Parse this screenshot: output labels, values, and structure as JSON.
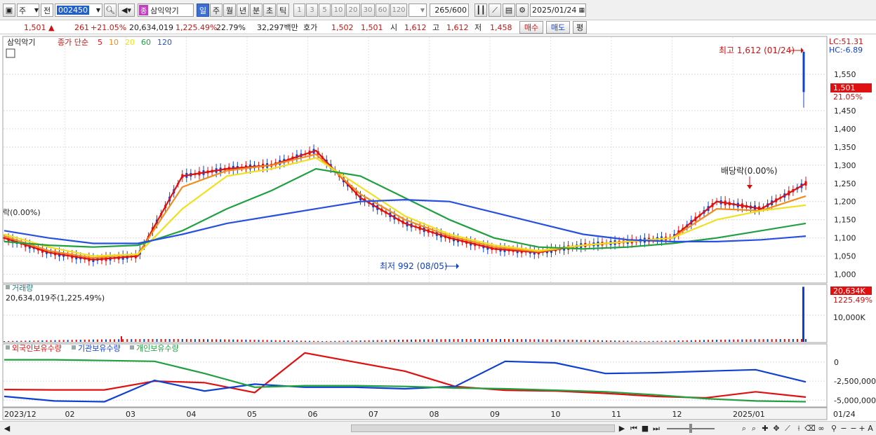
{
  "toolbar": {
    "market": "주",
    "prev": "전",
    "code": "002450",
    "name": "삼익악기",
    "badge": "종",
    "periods": [
      "일",
      "주",
      "월",
      "년",
      "분",
      "초",
      "틱"
    ],
    "active_period": "일",
    "minute_steps": [
      "1",
      "3",
      "5",
      "10",
      "20",
      "30",
      "60",
      "120"
    ],
    "count": "265",
    "total": "/600",
    "date": "2025/01/24"
  },
  "quote": {
    "price": "1,501",
    "change": "261",
    "change_pct": "+21.05%",
    "volume": "20,634,019",
    "volume_pct": "1,225.49%",
    "turnover": "22.79%",
    "amount": "32,297백만",
    "bid_label": "호가",
    "ask": "1,502",
    "bid": "1,501",
    "open_label": "시",
    "open": "1,612",
    "high_label": "고",
    "high": "1,612",
    "low_label": "저",
    "low": "1,458",
    "buy_button": "매수",
    "sell_button": "매도",
    "eval_button": "평"
  },
  "price_panel": {
    "title": "삼익악기",
    "legend_type": "종가 단순",
    "ma_periods": [
      "5",
      "10",
      "20",
      "60",
      "120"
    ],
    "ma_colors": [
      "#e01010",
      "#f08c20",
      "#f0e020",
      "#20a040",
      "#2850e0"
    ],
    "lc_label": "LC:51.31",
    "hc_label": "HC:-6.89",
    "last_price_tag": "1,501",
    "last_pct_tag": "21.05%",
    "high_note": "최고 1,612 (01/24)",
    "low_note": "최저 992 (08/05)",
    "div_note": "배당락(0.00%)",
    "div_note_left": "락(0.00%)"
  },
  "volume_panel": {
    "title": "거래량",
    "value": "20,634,019주(1,225.49%)",
    "tag": "20,634K",
    "tag_pct": "1225.49%",
    "tick": "10,000K"
  },
  "holdings_panel": {
    "legend": [
      {
        "name": "외국인보유수량",
        "color": "#e01010"
      },
      {
        "name": "기관보유수량",
        "color": "#1040d0"
      },
      {
        "name": "개인보유수량",
        "color": "#20a040"
      }
    ],
    "ticks": [
      "0",
      "-2,500,000",
      "-5,000,000"
    ]
  },
  "x_axis": {
    "labels": [
      "2023/12",
      "02",
      "03",
      "04",
      "05",
      "06",
      "07",
      "08",
      "09",
      "10",
      "11",
      "12",
      "2025/01",
      "01/24"
    ]
  },
  "chart_data": [
    {
      "type": "line",
      "title": "삼익악기",
      "xlabel": "",
      "ylabel": "",
      "categories": [
        "2023/12",
        "02",
        "03",
        "04",
        "05",
        "06",
        "07",
        "08",
        "09",
        "10",
        "11",
        "12",
        "2025/01",
        "01/24"
      ],
      "ylim": [
        980,
        1650
      ],
      "y_ticks": [
        1000,
        1050,
        1100,
        1150,
        1200,
        1250,
        1300,
        1350,
        1400,
        1450,
        1550
      ],
      "series": [
        {
          "name": "5",
          "values": [
            1100,
            1060,
            1040,
            1050,
            1270,
            1290,
            1300,
            1340,
            1210,
            1140,
            1100,
            1070,
            1060,
            1080,
            1090,
            1100,
            1200,
            1180,
            1250
          ]
        },
        {
          "name": "10",
          "values": [
            1105,
            1065,
            1045,
            1055,
            1240,
            1285,
            1300,
            1330,
            1220,
            1150,
            1105,
            1075,
            1062,
            1080,
            1090,
            1100,
            1180,
            1175,
            1215
          ]
        },
        {
          "name": "20",
          "values": [
            1110,
            1075,
            1050,
            1055,
            1180,
            1270,
            1290,
            1320,
            1240,
            1160,
            1110,
            1080,
            1065,
            1080,
            1090,
            1100,
            1150,
            1175,
            1190
          ]
        },
        {
          "name": "60",
          "values": [
            1090,
            1080,
            1075,
            1080,
            1120,
            1180,
            1230,
            1290,
            1270,
            1210,
            1150,
            1100,
            1075,
            1070,
            1075,
            1085,
            1100,
            1120,
            1140
          ]
        },
        {
          "name": "120",
          "values": [
            1120,
            1100,
            1085,
            1085,
            1110,
            1140,
            1160,
            1180,
            1200,
            1205,
            1200,
            1170,
            1140,
            1110,
            1095,
            1090,
            1090,
            1095,
            1105
          ]
        }
      ],
      "annotations": [
        {
          "text": "최고 1,612 (01/24)",
          "value": 1612
        },
        {
          "text": "최저 992 (08/05)",
          "value": 992
        },
        {
          "text": "배당락(0.00%)",
          "value": 1205
        }
      ],
      "grid": true
    },
    {
      "type": "bar",
      "title": "거래량",
      "ylim": [
        0,
        21000000
      ],
      "y_ticks": [
        10000000
      ],
      "series": [
        {
          "name": "거래량",
          "values": [
            20634019
          ]
        }
      ]
    },
    {
      "type": "line",
      "ylim": [
        -5800000,
        1000000
      ],
      "y_ticks": [
        0,
        -2500000,
        -5000000
      ],
      "series": [
        {
          "name": "외국인보유수량",
          "values": [
            -3600000,
            -3650000,
            -3650000,
            -2500000,
            -2700000,
            -4000000,
            1200000,
            0,
            -1200000,
            -3200000,
            -3700000,
            -3800000,
            -4100000,
            -4500000,
            -4700000,
            -3900000,
            -4600000
          ]
        },
        {
          "name": "기관보유수량",
          "values": [
            -4500000,
            -5100000,
            -5200000,
            -2400000,
            -3800000,
            -2900000,
            -3300000,
            -3300000,
            -3500000,
            -3200000,
            100000,
            -100000,
            -1500000,
            -1400000,
            -1200000,
            -1000000,
            -2600000
          ]
        },
        {
          "name": "개인보유수량",
          "values": [
            300000,
            300000,
            200000,
            100000,
            -1500000,
            -3300000,
            -3100000,
            -3100000,
            -3200000,
            -3400000,
            -3500000,
            -3700000,
            -3900000,
            -4300000,
            -4800000,
            -5100000,
            -5200000
          ]
        }
      ]
    }
  ]
}
